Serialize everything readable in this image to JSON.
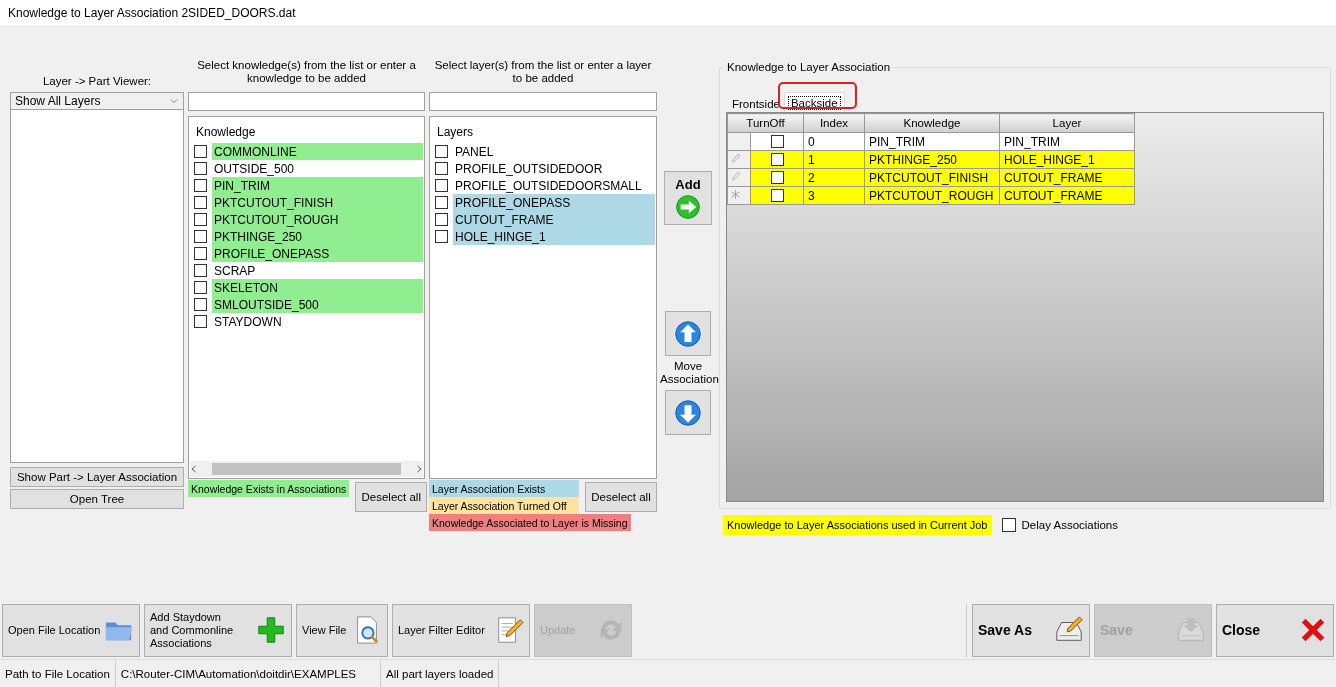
{
  "window": {
    "title": "Knowledge to Layer Association 2SIDED_DOORS.dat"
  },
  "viewer": {
    "label": "Layer -> Part Viewer:",
    "dropdown": "Show All Layers",
    "buttons": [
      "Show Part -> Layer Association",
      "Open Tree"
    ]
  },
  "knowledge_panel": {
    "instruction": "Select knowledge(s) from the list or enter a knowledge to be added",
    "header": "Knowledge",
    "items": [
      {
        "label": "COMMONLINE",
        "checked": false,
        "highlighted": true
      },
      {
        "label": "OUTSIDE_500",
        "checked": false,
        "highlighted": false
      },
      {
        "label": "PIN_TRIM",
        "checked": false,
        "highlighted": true
      },
      {
        "label": "PKTCUTOUT_FINISH",
        "checked": false,
        "highlighted": true
      },
      {
        "label": "PKTCUTOUT_ROUGH",
        "checked": false,
        "highlighted": true
      },
      {
        "label": "PKTHINGE_250",
        "checked": false,
        "highlighted": true
      },
      {
        "label": "PROFILE_ONEPASS",
        "checked": false,
        "highlighted": true
      },
      {
        "label": "SCRAP",
        "checked": false,
        "highlighted": false
      },
      {
        "label": "SKELETON",
        "checked": false,
        "highlighted": true
      },
      {
        "label": "SMLOUTSIDE_500",
        "checked": false,
        "highlighted": true
      },
      {
        "label": "STAYDOWN",
        "checked": false,
        "highlighted": false
      }
    ],
    "legend": [
      {
        "label": "Knowledge Exists in Associations",
        "color": "#90ee90"
      }
    ],
    "deselect": "Deselect all"
  },
  "layers_panel": {
    "instruction": "Select layer(s) from the list or enter a layer to be added",
    "header": "Layers",
    "items": [
      {
        "label": "PANEL",
        "checked": false,
        "highlighted": false
      },
      {
        "label": "PROFILE_OUTSIDEDOOR",
        "checked": false,
        "highlighted": false
      },
      {
        "label": "PROFILE_OUTSIDEDOORSMALL",
        "checked": false,
        "highlighted": false
      },
      {
        "label": "PROFILE_ONEPASS",
        "checked": false,
        "highlighted": true
      },
      {
        "label": "CUTOUT_FRAME",
        "checked": false,
        "highlighted": true
      },
      {
        "label": "HOLE_HINGE_1",
        "checked": false,
        "highlighted": true
      }
    ],
    "legend": [
      {
        "label": "Layer Association Exists",
        "color": "#add8e6"
      },
      {
        "label": "Layer Association Turned Off",
        "color": "#ffe4a0"
      },
      {
        "label": "Knowledge Associated to Layer is Missing",
        "color": "#f08080"
      }
    ],
    "deselect": "Deselect all"
  },
  "actions": {
    "add": "Add",
    "move": "Move Association"
  },
  "associations": {
    "title": "Knowledge to Layer Association",
    "tabs": [
      {
        "label": "Frontside",
        "selected": false,
        "annotated": false
      },
      {
        "label": "Backside",
        "selected": true,
        "annotated": true
      }
    ],
    "columns": [
      "TurnOff",
      "Index",
      "Knowledge",
      "Layer"
    ],
    "rows": [
      {
        "kind": "plain",
        "turn_off": false,
        "index": "0",
        "knowledge": "PIN_TRIM",
        "layer": "PIN_TRIM",
        "highlighted": false
      },
      {
        "kind": "edited",
        "turn_off": false,
        "index": "1",
        "knowledge": "PKTHINGE_250",
        "layer": "HOLE_HINGE_1",
        "highlighted": true
      },
      {
        "kind": "edited",
        "turn_off": false,
        "index": "2",
        "knowledge": "PKTCUTOUT_FINISH",
        "layer": "CUTOUT_FRAME",
        "highlighted": true
      },
      {
        "kind": "new",
        "turn_off": false,
        "index": "3",
        "knowledge": "PKTCUTOUT_ROUGH",
        "layer": "CUTOUT_FRAME",
        "highlighted": true
      }
    ],
    "legend": {
      "label": "Knowledge to Layer Associations used in Current Job",
      "color": "#ffff00"
    },
    "delay": {
      "label": "Delay Associations",
      "checked": false
    }
  },
  "toolbar": [
    {
      "label": "Open File Location",
      "kind": "folder",
      "disabled": false
    },
    {
      "label": "Add Staydown and Commonline Associations",
      "kind": "plus",
      "disabled": false
    },
    {
      "label": "View File",
      "kind": "view",
      "disabled": false
    },
    {
      "label": "Layer Filter Editor",
      "kind": "edit",
      "disabled": false
    },
    {
      "label": "Update",
      "kind": "refresh",
      "disabled": true
    }
  ],
  "file_buttons": [
    {
      "label": "Save As",
      "kind": "saveas",
      "disabled": false
    },
    {
      "label": "Save",
      "kind": "save",
      "disabled": true
    },
    {
      "label": "Close",
      "kind": "close",
      "disabled": false
    }
  ],
  "status_bar": [
    "Path to File Location",
    "C:\\Router-CIM\\Automation\\doitdir\\EXAMPLES",
    "All part layers loaded"
  ]
}
